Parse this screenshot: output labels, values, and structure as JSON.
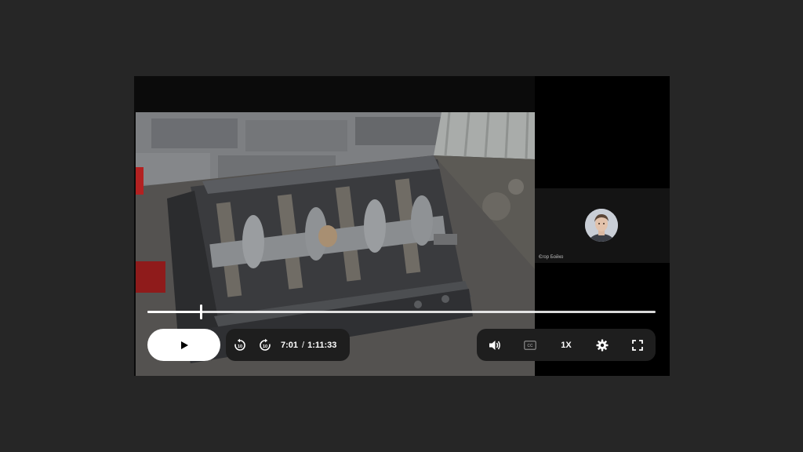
{
  "player": {
    "current_time": "7:01",
    "time_separator": "/",
    "duration": "1:11:33",
    "progress_fraction": 0.105,
    "speed_label": "1X",
    "icons": {
      "play": "play-icon",
      "rewind": "rewind-10-icon",
      "forward": "forward-10-icon",
      "volume": "volume-icon",
      "captions": "closed-captions-icon",
      "settings": "gear-icon",
      "fullscreen": "fullscreen-icon"
    },
    "colors": {
      "background": "#262626",
      "player": "#0b0b0b",
      "controls": "#1e1e1e",
      "accent": "#ffffff"
    }
  },
  "participant": {
    "name": "Єгор Бойко"
  }
}
